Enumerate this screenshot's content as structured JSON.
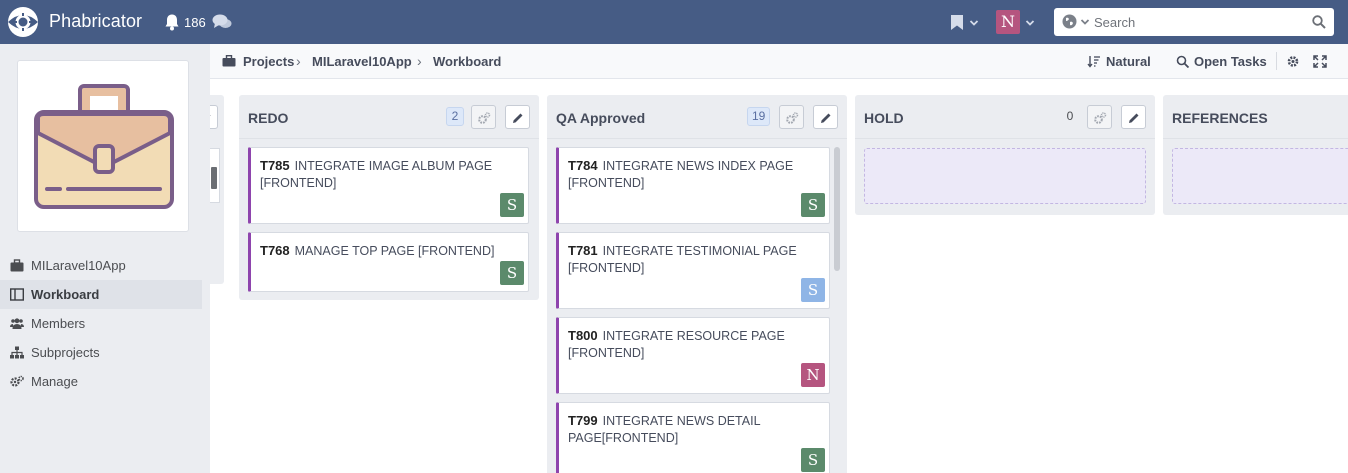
{
  "app": {
    "brand": "Phabricator",
    "notification_count": "186",
    "user_avatar_letter": "N",
    "accent_color": "#465c85"
  },
  "search": {
    "placeholder": "Search"
  },
  "sidebar": {
    "items": [
      {
        "label": "MILaravel10App",
        "icon": "briefcase-icon"
      },
      {
        "label": "Workboard",
        "icon": "columns-icon",
        "active": true
      },
      {
        "label": "Members",
        "icon": "users-icon"
      },
      {
        "label": "Subprojects",
        "icon": "sitemap-icon"
      },
      {
        "label": "Manage",
        "icon": "gears-icon"
      }
    ]
  },
  "breadcrumbs": {
    "items": [
      "Projects",
      "MILaravel10App",
      "Workboard"
    ]
  },
  "toolbar": {
    "sort_label": "Natural",
    "filter_label": "Open Tasks"
  },
  "columns": [
    {
      "title": "REDO",
      "count": "2",
      "cards": [
        {
          "id": "T785",
          "title": "INTEGRATE IMAGE ALBUM PAGE [FRONTEND]",
          "avatar": "S",
          "avatar_color": "#5b8a6b"
        },
        {
          "id": "T768",
          "title": "MANAGE TOP PAGE [FRONTEND]",
          "avatar": "S",
          "avatar_color": "#5b8a6b"
        }
      ]
    },
    {
      "title": "QA Approved",
      "count": "19",
      "cards": [
        {
          "id": "T784",
          "title": "INTEGRATE NEWS INDEX PAGE [FRONTEND]",
          "avatar": "S",
          "avatar_color": "#5b8a6b"
        },
        {
          "id": "T781",
          "title": "INTEGRATE TESTIMONIAL PAGE [FRONTEND]",
          "avatar": "S",
          "avatar_color": "#8fb5e6"
        },
        {
          "id": "T800",
          "title": "INTEGRATE RESOURCE PAGE [FRONTEND]",
          "avatar": "N",
          "avatar_color": "#b5557f"
        },
        {
          "id": "T799",
          "title": "INTEGRATE NEWS DETAIL PAGE[FRONTEND]",
          "avatar": "S",
          "avatar_color": "#5b8a6b"
        }
      ]
    },
    {
      "title": "HOLD",
      "count": "0",
      "cards": []
    },
    {
      "title": "REFERENCES",
      "cards": []
    }
  ]
}
